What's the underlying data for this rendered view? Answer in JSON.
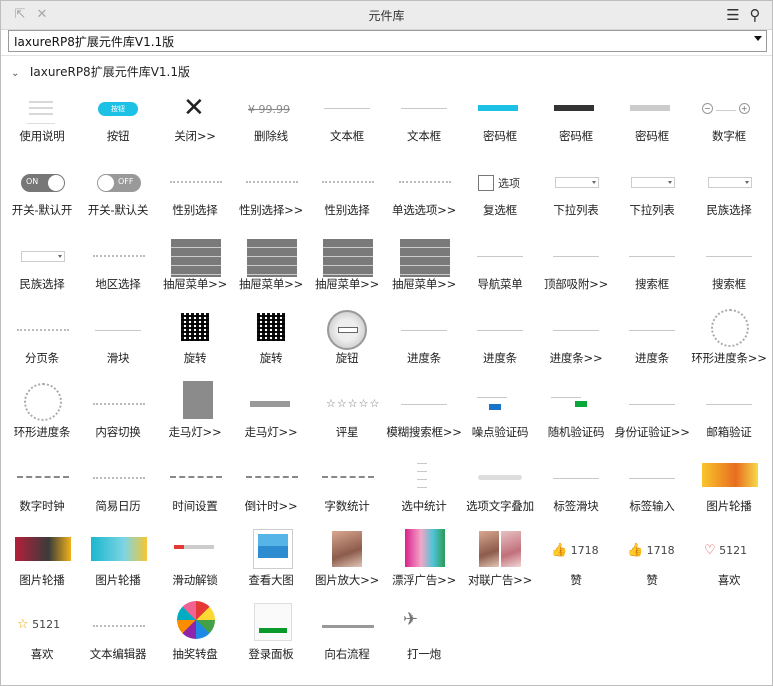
{
  "window": {
    "title": "元件库",
    "selected_library": "IaxureRP8扩展元件库V1.1版"
  },
  "group": {
    "label": "IaxureRP8扩展元件库V1.1版"
  },
  "thumb_text": {
    "button": "按钮",
    "strike": "¥ 99.99",
    "switch_on": "ON",
    "switch_off": "OFF",
    "checkbox": "选项",
    "like_count": "1718",
    "fav_count": "5121",
    "star_count": "5121"
  },
  "items": [
    {
      "label": "使用说明",
      "thumb": "doc"
    },
    {
      "label": "按钮",
      "thumb": "pill"
    },
    {
      "label": "关闭>>",
      "thumb": "close"
    },
    {
      "label": "删除线",
      "thumb": "strike"
    },
    {
      "label": "文本框",
      "thumb": "line"
    },
    {
      "label": "文本框",
      "thumb": "line"
    },
    {
      "label": "密码框",
      "thumb": "pwd-cyan"
    },
    {
      "label": "密码框",
      "thumb": "pwd-dark"
    },
    {
      "label": "密码框",
      "thumb": "pwd-gray"
    },
    {
      "label": "数字框",
      "thumb": "number"
    },
    {
      "label": "开关-默认开",
      "thumb": "switch-on"
    },
    {
      "label": "开关-默认关",
      "thumb": "switch-off"
    },
    {
      "label": "性别选择",
      "thumb": "dots"
    },
    {
      "label": "性别选择>>",
      "thumb": "dots"
    },
    {
      "label": "性别选择",
      "thumb": "dots"
    },
    {
      "label": "单选选项>>",
      "thumb": "dots"
    },
    {
      "label": "复选框",
      "thumb": "checkbox"
    },
    {
      "label": "下拉列表",
      "thumb": "select"
    },
    {
      "label": "下拉列表",
      "thumb": "select"
    },
    {
      "label": "民族选择",
      "thumb": "select"
    },
    {
      "label": "民族选择",
      "thumb": "select"
    },
    {
      "label": "地区选择",
      "thumb": "dots"
    },
    {
      "label": "抽屉菜单>>",
      "thumb": "stack"
    },
    {
      "label": "抽屉菜单>>",
      "thumb": "stack"
    },
    {
      "label": "抽屉菜单>>",
      "thumb": "stack"
    },
    {
      "label": "抽屉菜单>>",
      "thumb": "stack"
    },
    {
      "label": "导航菜单",
      "thumb": "line"
    },
    {
      "label": "顶部吸附>>",
      "thumb": "line"
    },
    {
      "label": "搜索框",
      "thumb": "line"
    },
    {
      "label": "搜索框",
      "thumb": "line"
    },
    {
      "label": "分页条",
      "thumb": "dots"
    },
    {
      "label": "滑块",
      "thumb": "line"
    },
    {
      "label": "旋转",
      "thumb": "qr"
    },
    {
      "label": "旋转",
      "thumb": "qr"
    },
    {
      "label": "旋钮",
      "thumb": "knob"
    },
    {
      "label": "进度条",
      "thumb": "line"
    },
    {
      "label": "进度条",
      "thumb": "line"
    },
    {
      "label": "进度条>>",
      "thumb": "line"
    },
    {
      "label": "进度条",
      "thumb": "line"
    },
    {
      "label": "环形进度条>>",
      "thumb": "ring"
    },
    {
      "label": "环形进度条",
      "thumb": "ring"
    },
    {
      "label": "内容切换",
      "thumb": "dots"
    },
    {
      "label": "走马灯>>",
      "thumb": "gray"
    },
    {
      "label": "走马灯>>",
      "thumb": "graybar"
    },
    {
      "label": "评星",
      "thumb": "stars"
    },
    {
      "label": "模糊搜索框>>",
      "thumb": "line"
    },
    {
      "label": "噪点验证码",
      "thumb": "captcha-blue"
    },
    {
      "label": "随机验证码",
      "thumb": "captcha-green"
    },
    {
      "label": "身份证验证>>",
      "thumb": "line"
    },
    {
      "label": "邮箱验证",
      "thumb": "line"
    },
    {
      "label": "数字时钟",
      "thumb": "clock"
    },
    {
      "label": "简易日历",
      "thumb": "dots"
    },
    {
      "label": "时间设置",
      "thumb": "clock"
    },
    {
      "label": "倒计时>>",
      "thumb": "clock"
    },
    {
      "label": "字数统计",
      "thumb": "clock"
    },
    {
      "label": "选中统计",
      "thumb": "list"
    },
    {
      "label": "选项文字叠加",
      "thumb": "slider"
    },
    {
      "label": "标签滑块",
      "thumb": "line"
    },
    {
      "label": "标签输入",
      "thumb": "line"
    },
    {
      "label": "图片轮播",
      "thumb": "banner-yellow"
    },
    {
      "label": "图片轮播",
      "thumb": "banner-red"
    },
    {
      "label": "图片轮播",
      "thumb": "banner-cyan"
    },
    {
      "label": "滑动解锁",
      "thumb": "unlock"
    },
    {
      "label": "查看大图",
      "thumb": "pic"
    },
    {
      "label": "图片放大>>",
      "thumb": "photo"
    },
    {
      "label": "漂浮广告>>",
      "thumb": "banner-float"
    },
    {
      "label": "对联广告>>",
      "thumb": "photo2"
    },
    {
      "label": "赞",
      "thumb": "like"
    },
    {
      "label": "赞",
      "thumb": "like"
    },
    {
      "label": "喜欢",
      "thumb": "fav"
    },
    {
      "label": "喜欢",
      "thumb": "star"
    },
    {
      "label": "文本编辑器",
      "thumb": "dots"
    },
    {
      "label": "抽奖转盘",
      "thumb": "wheel"
    },
    {
      "label": "登录面板",
      "thumb": "login"
    },
    {
      "label": "向右流程",
      "thumb": "flow"
    },
    {
      "label": "打一炮",
      "thumb": "gun"
    }
  ]
}
